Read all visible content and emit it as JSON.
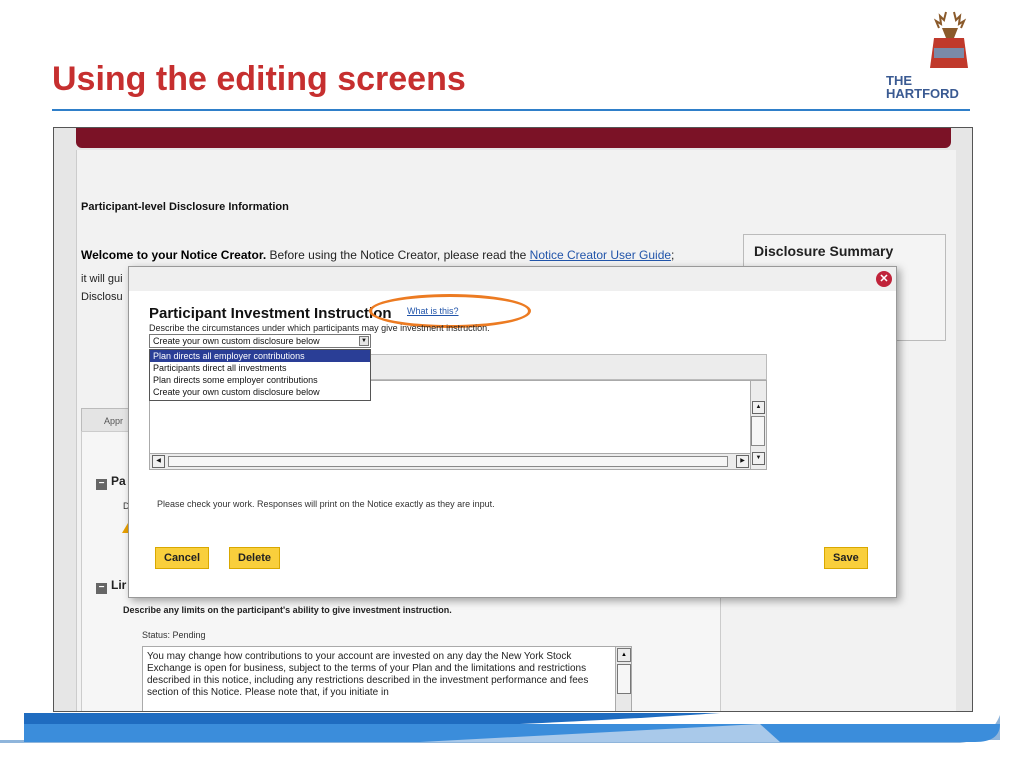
{
  "slide": {
    "title": "Using the editing screens",
    "logo_line1": "THE",
    "logo_line2": "HARTFORD"
  },
  "page": {
    "heading": "Participant-level Disclosure Information",
    "welcome_bold": "Welcome to your Notice Creator.",
    "welcome_text": " Before using the Notice Creator, please read the ",
    "welcome_link": "Notice Creator User Guide",
    "welcome_end": ";",
    "welcome_line2": "it will gui",
    "welcome_line3": "Disclosu",
    "disclosure_summary": "Disclosure Summary",
    "tab_appr": "Appr",
    "section_pa": "Pa",
    "section_pa_desc": "D",
    "section_li": "Lir",
    "limits_describe": "Describe any limits on the participant's ability to give investment instruction.",
    "limits_status": "Status: Pending",
    "limits_text": "You may change how contributions to your account are invested on any day the New York Stock Exchange is open for business, subject to the terms of your Plan and the limitations and restrictions described in this notice, including any restrictions described in the investment performance and fees section of this Notice.  Please note that, if you initiate in"
  },
  "modal": {
    "title": "Participant Investment Instruction",
    "what_link": "What is this?",
    "describe": "Describe the circumstances under which participants may give investment instruction.",
    "select_value": "Create your own custom disclosure below",
    "options": [
      "Plan directs all employer contributions",
      "Participants direct all investments",
      "Plan directs some employer contributions",
      "Create your own custom disclosure below"
    ],
    "check_note": "Please check your work. Responses will print on the Notice exactly as they are input.",
    "cancel": "Cancel",
    "delete": "Delete",
    "save": "Save"
  },
  "colors": {
    "title_red": "#c62f2f",
    "rule_blue": "#2f7fc9",
    "maroon": "#7b1226",
    "button_yellow": "#f9cf3c",
    "highlight_orange": "#ec7b22",
    "selected_option": "#2a3e96",
    "close_red": "#c0233a"
  },
  "icons": {
    "close": "close-icon",
    "warning": "warning-icon",
    "collapse": "minus-icon",
    "logo": "stag-logo-icon"
  }
}
